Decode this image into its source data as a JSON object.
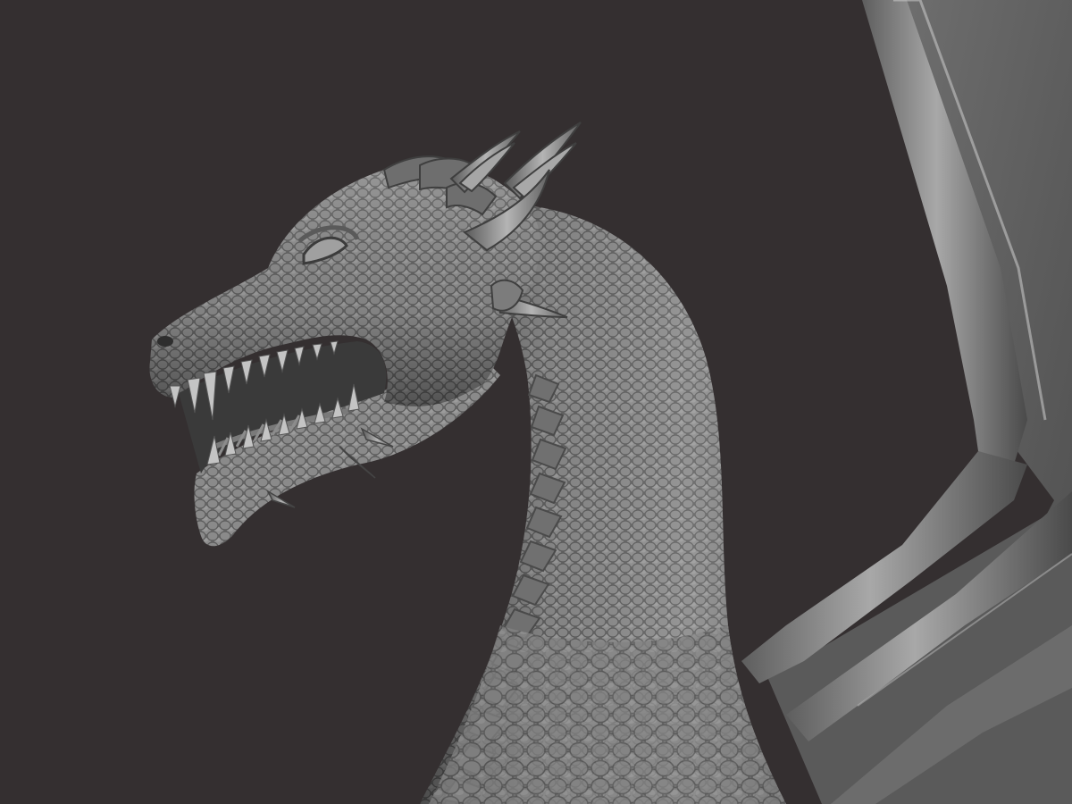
{
  "scene": {
    "subject": "dragon-sculpt-render",
    "background_color": "#342f30",
    "material_color": "#8a8a8a",
    "highlight_color": "#c8c8c8",
    "shadow_color": "#2a2a2a"
  }
}
